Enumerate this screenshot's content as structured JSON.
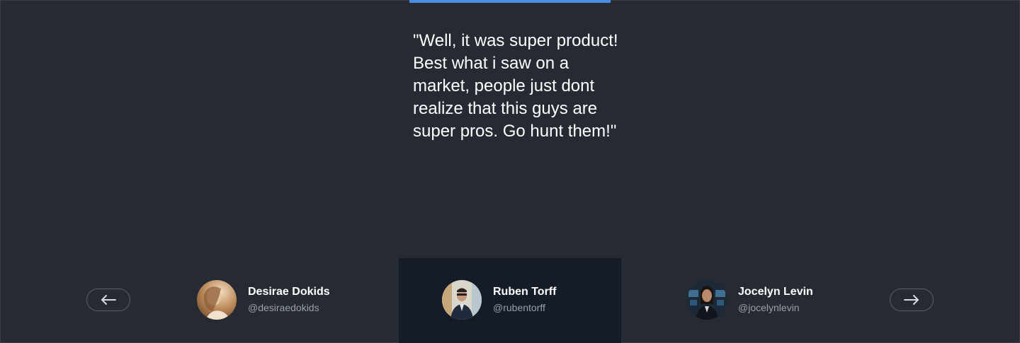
{
  "testimonial": {
    "quote": "\"Well, it was super product! Best what i saw on a market, people just dont realize that this guys are super pros. Go hunt them!\""
  },
  "navigation": {
    "prev_icon": "arrow-left-icon",
    "next_icon": "arrow-right-icon"
  },
  "people": [
    {
      "name": "Desirae Dokids",
      "handle": "@desiraedokids",
      "avatar": "avatar-photo"
    },
    {
      "name": "Ruben Torff",
      "handle": "@rubentorff",
      "avatar": "avatar-photo"
    },
    {
      "name": "Jocelyn Levin",
      "handle": "@jocelynlevin",
      "avatar": "avatar-photo"
    }
  ],
  "active_index": 1,
  "colors": {
    "background": "#262b33",
    "active_panel": "#161b28",
    "accent": "#4a90e2"
  }
}
